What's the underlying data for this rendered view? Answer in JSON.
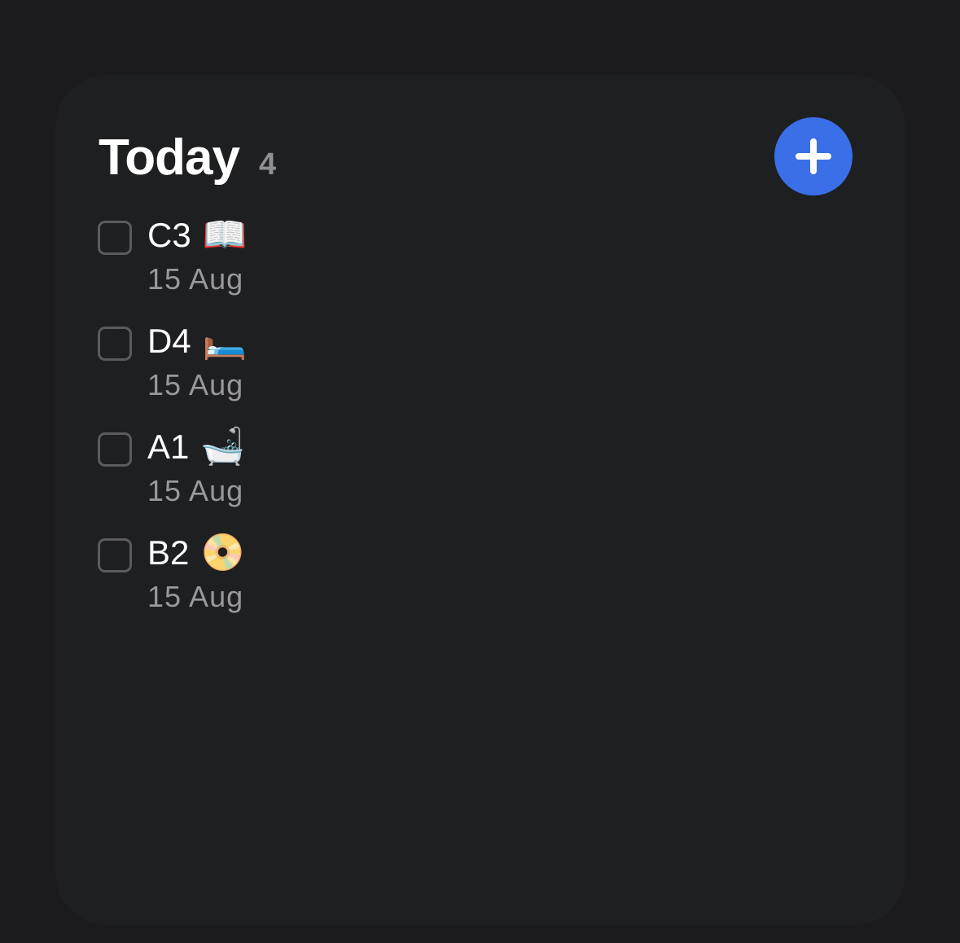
{
  "widget": {
    "title": "Today",
    "count": "4",
    "add_icon": "plus-icon",
    "accent_color": "#3a6fe8"
  },
  "tasks": [
    {
      "name": "C3",
      "emoji": "📖",
      "date": "15 Aug"
    },
    {
      "name": "D4",
      "emoji": "🛏️",
      "date": "15 Aug"
    },
    {
      "name": "A1",
      "emoji": "🛁",
      "date": "15 Aug"
    },
    {
      "name": "B2",
      "emoji": "📀",
      "date": "15 Aug"
    }
  ]
}
